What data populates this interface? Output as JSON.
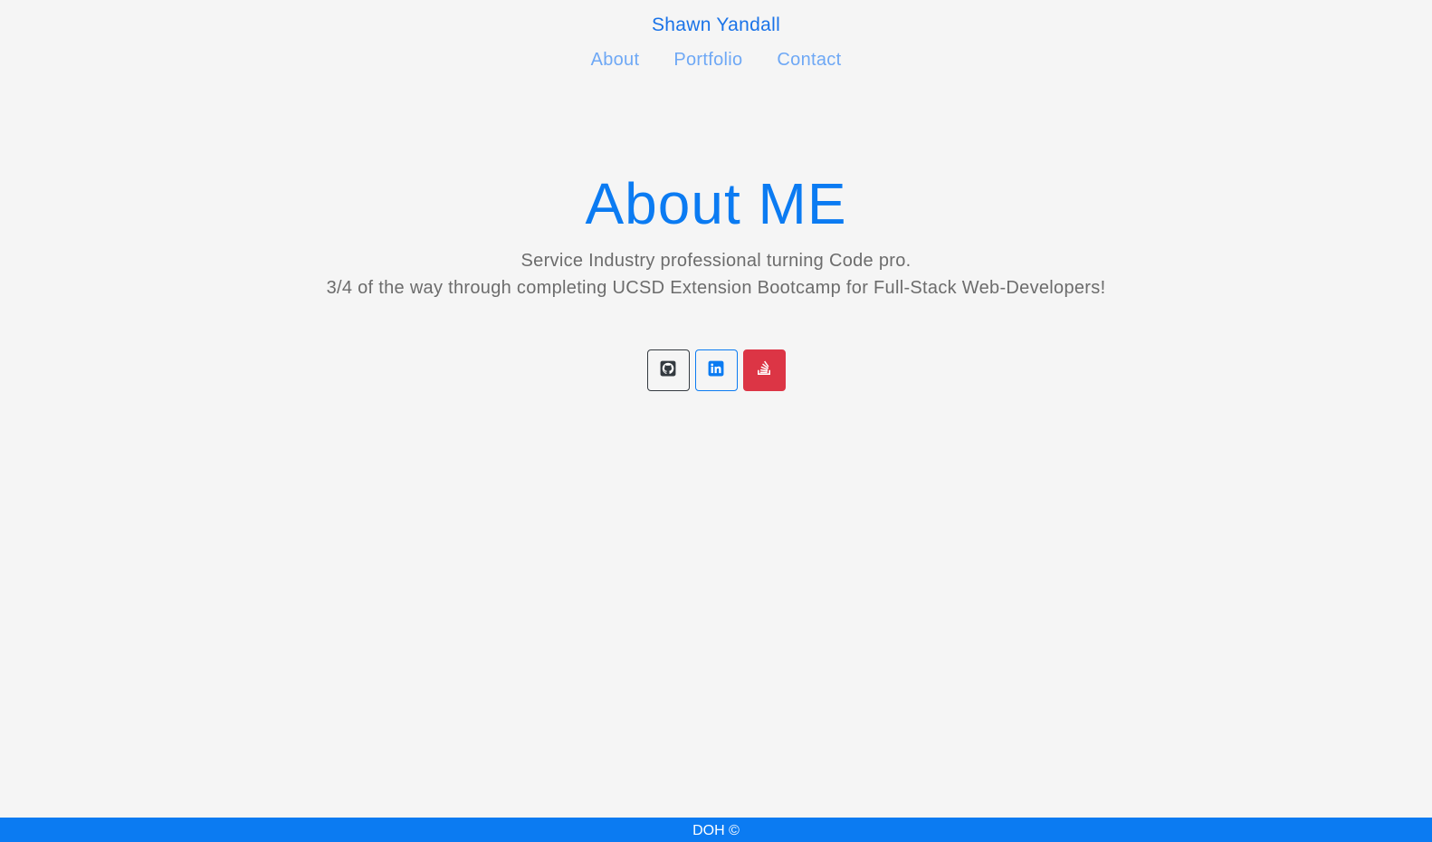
{
  "header": {
    "brand": "Shawn Yandall",
    "nav": [
      {
        "label": "About"
      },
      {
        "label": "Portfolio"
      },
      {
        "label": "Contact"
      }
    ]
  },
  "hero": {
    "title": "About ME",
    "line1": "Service Industry professional turning Code pro.",
    "line2": "3/4 of the way through completing UCSD Extension Bootcamp for Full-Stack Web-Developers!"
  },
  "socials": [
    {
      "icon": "github-icon",
      "color": "#343a40"
    },
    {
      "icon": "linkedin-icon",
      "color": "#0b7bf2"
    },
    {
      "icon": "stackoverflow-icon",
      "color": "#dc3545"
    }
  ],
  "footer": {
    "text": "DOH ©"
  },
  "colors": {
    "background": "#f5f5f5",
    "accent": "#0b7bf2",
    "nav": "#6ea8f5",
    "muted_text": "#6c6c6c"
  }
}
